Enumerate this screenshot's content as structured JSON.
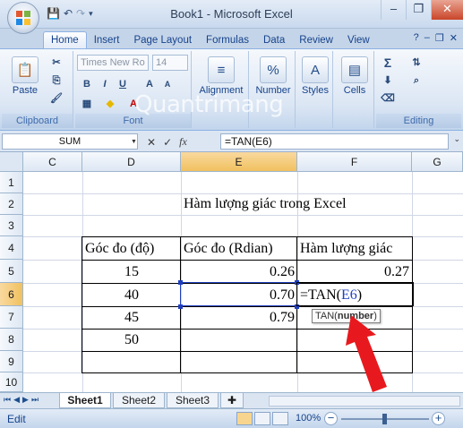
{
  "window": {
    "title": "Book1 - Microsoft Excel"
  },
  "quick_access": {
    "save_icon": "save-icon",
    "undo_icon": "undo-icon",
    "redo_icon": "redo-icon",
    "customize_icon": "chevron-down-icon"
  },
  "tabs": [
    "Home",
    "Insert",
    "Page Layout",
    "Formulas",
    "Data",
    "Review",
    "View"
  ],
  "ribbon": {
    "clipboard": {
      "paste_label": "Paste",
      "group_label": "Clipboard"
    },
    "font": {
      "font_name": "Times New Ro",
      "font_size": "14",
      "group_label": "Font",
      "bold": "B",
      "italic": "I",
      "underline": "U"
    },
    "alignment_label": "Alignment",
    "number_label": "Number",
    "styles_label": "Styles",
    "cells_label": "Cells",
    "editing_label": "Editing",
    "watermark_text": "Quantrimang"
  },
  "formula_bar": {
    "name_box": "SUM",
    "fx_label": "fx",
    "cancel": "✕",
    "enter": "✓",
    "formula": "=TAN(E6)"
  },
  "grid": {
    "columns": [
      "C",
      "D",
      "E",
      "F",
      "G"
    ],
    "rows": [
      "1",
      "2",
      "3",
      "4",
      "5",
      "6",
      "7",
      "8",
      "9",
      "10"
    ],
    "selected_column": "E",
    "selected_row": "6",
    "title_cell": "Hàm lượng giác trong Excel",
    "header_d": "Góc đo (độ)",
    "header_e": "Góc đo (Rdian)",
    "header_f": "Hàm lượng giác",
    "d5": "15",
    "d6": "40",
    "d7": "45",
    "d8": "50",
    "e5": "0.26",
    "e6": "0.70",
    "e7": "0.79",
    "f5": "0.27",
    "f6_prefix": "=TAN(",
    "f6_ref": "E6",
    "f6_suffix": ")",
    "tooltip_fn": "TAN(",
    "tooltip_arg": "number",
    "tooltip_close": ")",
    "ref_color": "#1f3fbf",
    "arrow_color": "#e8191e"
  },
  "sheets": {
    "tabs": [
      "Sheet1",
      "Sheet2",
      "Sheet3"
    ],
    "active": "Sheet1"
  },
  "status": {
    "mode": "Edit",
    "zoom": "100%"
  }
}
